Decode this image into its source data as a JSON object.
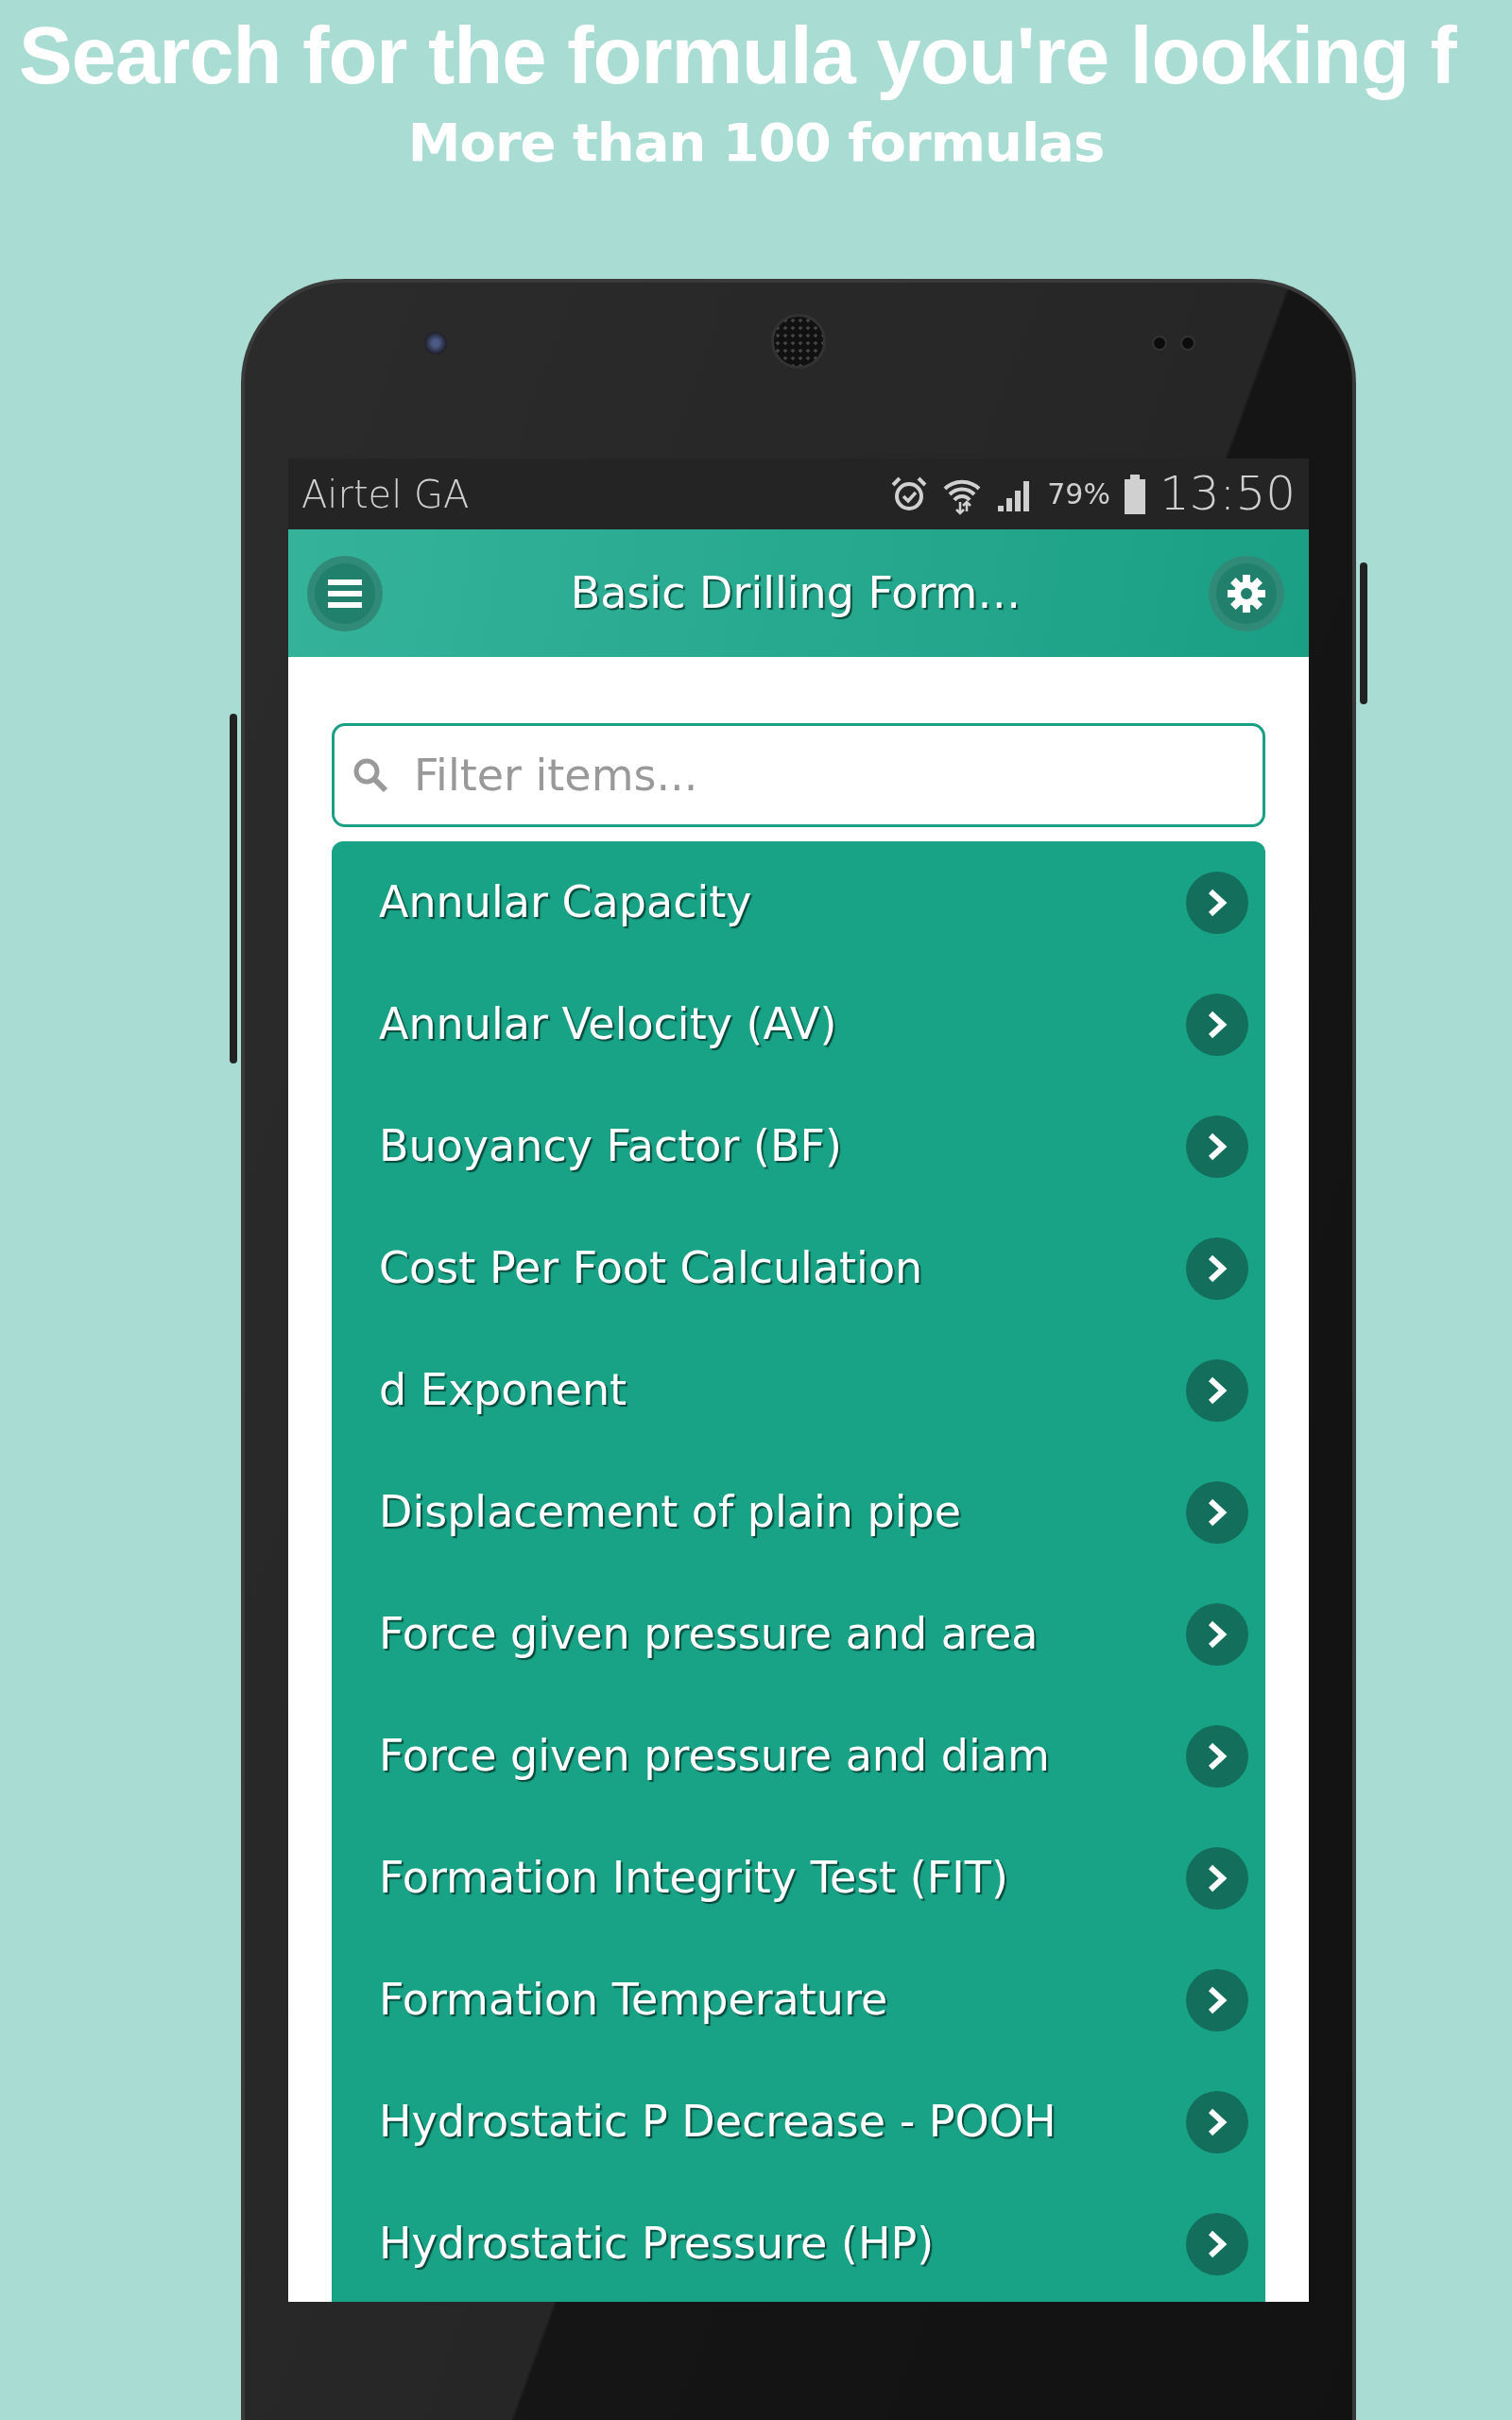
{
  "promo": {
    "headline": "Search for the formula you're looking f",
    "subheadline": "More than 100 formulas"
  },
  "status_bar": {
    "carrier": "Airtel GA",
    "battery": "79%",
    "time": "13:50"
  },
  "app_bar": {
    "title": "Basic Drilling Form…"
  },
  "search": {
    "placeholder": "Filter items..."
  },
  "items": [
    {
      "label": "Annular Capacity"
    },
    {
      "label": "Annular Velocity (AV)"
    },
    {
      "label": "Buoyancy Factor (BF)"
    },
    {
      "label": "Cost Per Foot Calculation"
    },
    {
      "label": "d Exponent"
    },
    {
      "label": "Displacement of plain pipe"
    },
    {
      "label": "Force given pressure and area"
    },
    {
      "label": "Force given pressure and diam"
    },
    {
      "label": "Formation Integrity Test (FIT)"
    },
    {
      "label": "Formation Temperature"
    },
    {
      "label": "Hydrostatic P Decrease - POOH"
    },
    {
      "label": "Hydrostatic Pressure (HP)"
    }
  ]
}
